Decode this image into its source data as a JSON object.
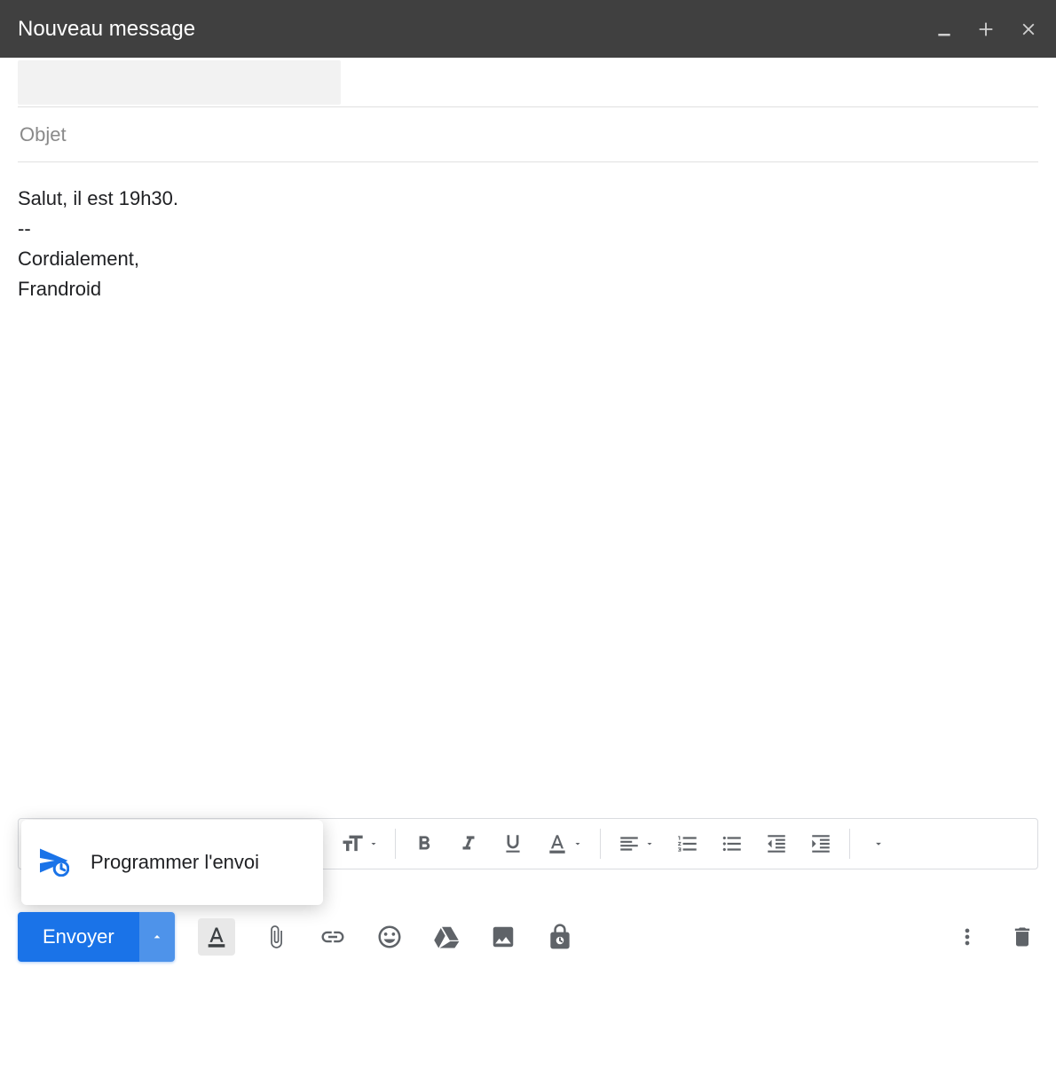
{
  "header": {
    "title": "Nouveau message"
  },
  "fields": {
    "subject_placeholder": "Objet",
    "subject_value": ""
  },
  "body": {
    "line1": "Salut, il est 19h30.",
    "sep": "--",
    "sig1": "Cordialement,",
    "sig2": "Frandroid"
  },
  "popup": {
    "schedule_label": "Programmer l'envoi"
  },
  "actions": {
    "send_label": "Envoyer"
  }
}
